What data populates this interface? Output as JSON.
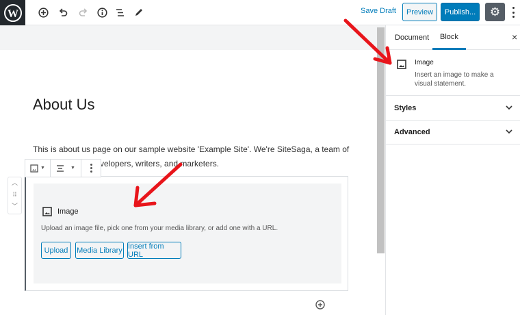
{
  "toolbar": {
    "save_draft": "Save Draft",
    "preview": "Preview",
    "publish": "Publish...",
    "icons": [
      "wordpress-logo",
      "add-block-icon",
      "undo-icon",
      "redo-icon",
      "info-icon",
      "list-view-icon",
      "edit-icon",
      "gear-icon",
      "more-icon"
    ]
  },
  "sidebar": {
    "tabs": [
      {
        "label": "Document"
      },
      {
        "label": "Block",
        "active": true
      }
    ],
    "block_name": "Image",
    "block_desc": "Insert an image to make a visual statement.",
    "panels": [
      {
        "label": "Styles"
      },
      {
        "label": "Advanced"
      }
    ]
  },
  "editor": {
    "title": "About Us",
    "paragraph_line1": "This is about us page on our sample website 'Example Site'. We're SiteSaga, a team of",
    "paragraph_line2": "velopers, writers, and marketers.",
    "image_block": {
      "label": "Image",
      "instructions": "Upload an image file, pick one from your media library, or add one with a URL.",
      "buttons": [
        "Upload",
        "Media Library",
        "Insert from URL"
      ]
    }
  },
  "colors": {
    "accent": "#007cba",
    "annotation_arrow": "#e8151b",
    "wp_bg": "#23282d"
  }
}
